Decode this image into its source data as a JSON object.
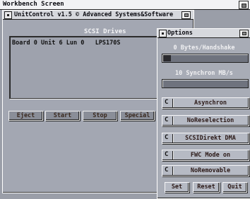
{
  "screen": {
    "title": "Workbench Screen"
  },
  "main_window": {
    "title": "UnitControl v1.5 © Advanced Systems&Software",
    "drives_label": "SCSI Drives",
    "drives": [
      {
        "text": "Board 0 Unit 6 Lun 0   LPS170S"
      }
    ],
    "buttons": {
      "eject": "Eject",
      "start": "Start",
      "stop": "Stop",
      "special": "Special"
    }
  },
  "options_window": {
    "title": "Options",
    "handshake": {
      "label": "0 Bytes/Handshake",
      "value_fraction": 0.03
    },
    "synchron": {
      "label": "10 Synchron MB/s",
      "value_fraction": 0.0
    },
    "cycles": [
      "Asynchron",
      "NoReselection",
      "SCSIDirekt DMA",
      "FWC Mode on",
      "NoRemovable"
    ],
    "buttons": {
      "set": "Set",
      "reset": "Reset",
      "quit": "Quit"
    }
  }
}
